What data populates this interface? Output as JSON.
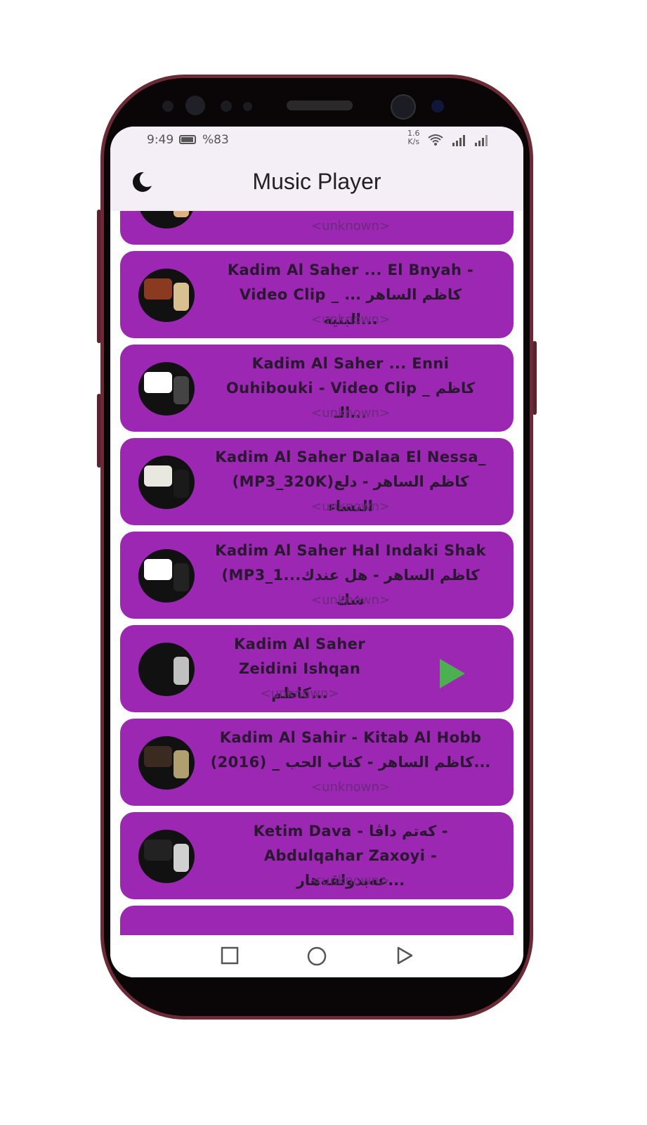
{
  "status": {
    "time": "9:49",
    "battery": "%83",
    "net_speed_value": "1.6",
    "net_speed_unit": "K/s"
  },
  "app": {
    "title": "Music Player",
    "theme_icon": "moon-icon"
  },
  "songs": [
    {
      "title": "",
      "artist": "<unknown>",
      "thumb_colors": [
        "#b05a20",
        "#e0b080"
      ]
    },
    {
      "title": "Kadim Al Saher ... El Bnyah -\nVideo Clip _ كاظم الساهر ... البنية...",
      "artist": "<unknown>",
      "thumb_colors": [
        "#8a3a20",
        "#d8c090"
      ]
    },
    {
      "title": "Kadim Al Saher ... Enni\nOuhibouki - Video Clip _ كاظم الـ...",
      "artist": "<unknown>",
      "thumb_colors": [
        "#ffffff",
        "#444444"
      ]
    },
    {
      "title": "Kadim Al Saher Dalaa El Nessa_\n(MP3_320K)كاظم الساهر - دلع النساء",
      "artist": "<unknown>",
      "thumb_colors": [
        "#e8e8e0",
        "#1a1a1a"
      ]
    },
    {
      "title": "Kadim Al Saher Hal Indaki Shak\n(MP3_1...كاظم الساهر - هل عندك شك",
      "artist": "<unknown>",
      "thumb_colors": [
        "#ffffff",
        "#222222"
      ]
    },
    {
      "title": "Kadim Al Saher\nZeidini Ishqan كاظم...",
      "artist": "<unknown>",
      "playing": true,
      "thumb_colors": [
        "#111111",
        "#c0c0c0"
      ]
    },
    {
      "title": "Kadim Al Sahir - Kitab Al Hobb\n(2016) _ كاظم الساهر - كتاب الحب...",
      "artist": "<unknown>",
      "thumb_colors": [
        "#3a2a20",
        "#b0a070"
      ]
    },
    {
      "title": "Ketim Dava - كەتم داڤا -\nAbdulqahar Zaxoyi - عەبدولقەهار...",
      "artist": "<unknown>",
      "thumb_colors": [
        "#222222",
        "#d0d0d0"
      ]
    },
    {
      "title": "",
      "artist": "",
      "thumb_colors": [
        "#333333",
        "#777777"
      ]
    }
  ],
  "icons": {
    "play": "play-icon",
    "nav_recents": "square-icon",
    "nav_home": "circle-icon",
    "nav_back": "triangle-icon"
  },
  "colors": {
    "card": "#9b27b3",
    "play": "#4caf50",
    "appbar": "#f4eef6"
  }
}
